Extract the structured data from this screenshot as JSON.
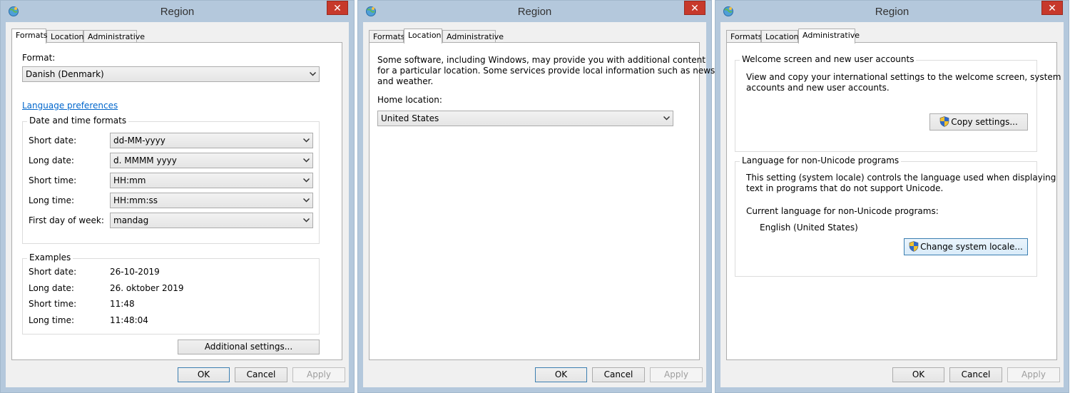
{
  "windows": [
    {
      "title": "Region",
      "close": "✕",
      "tabs": [
        "Formats",
        "Location",
        "Administrative"
      ],
      "active_tab": 0,
      "format_label": "Format:",
      "format_value": "Danish (Denmark)",
      "language_link": "Language preferences",
      "dt_group": "Date and time formats",
      "dt_rows": [
        {
          "label": "Short date:",
          "value": "dd-MM-yyyy"
        },
        {
          "label": "Long date:",
          "value": "d. MMMM yyyy"
        },
        {
          "label": "Short time:",
          "value": "HH:mm"
        },
        {
          "label": "Long time:",
          "value": "HH:mm:ss"
        },
        {
          "label": "First day of week:",
          "value": "mandag"
        }
      ],
      "examples_group": "Examples",
      "examples": [
        {
          "label": "Short date:",
          "value": "26-10-2019"
        },
        {
          "label": "Long date:",
          "value": "26. oktober 2019"
        },
        {
          "label": "Short time:",
          "value": "11:48"
        },
        {
          "label": "Long time:",
          "value": "11:48:04"
        }
      ],
      "additional_button": "Additional settings...",
      "ok": "OK",
      "cancel": "Cancel",
      "apply": "Apply"
    },
    {
      "title": "Region",
      "close": "✕",
      "tabs": [
        "Formats",
        "Location",
        "Administrative"
      ],
      "active_tab": 1,
      "description_line1": "Some software, including Windows, may provide you with additional content",
      "description_line2": "for a particular location. Some services provide local information such as news",
      "description_line3": "and weather.",
      "home_label": "Home location:",
      "home_value": "United States",
      "ok": "OK",
      "cancel": "Cancel",
      "apply": "Apply"
    },
    {
      "title": "Region",
      "close": "✕",
      "tabs": [
        "Formats",
        "Location",
        "Administrative"
      ],
      "active_tab": 2,
      "welcome_group": "Welcome screen and new user accounts",
      "welcome_line1": "View and copy your international settings to the welcome screen, system",
      "welcome_line2": "accounts and new user accounts.",
      "copy_button": "Copy settings...",
      "unicode_group": "Language for non-Unicode programs",
      "unicode_line1": "This setting (system locale) controls the language used when displaying",
      "unicode_line2": "text in programs that do not support Unicode.",
      "current_label": "Current language for non-Unicode programs:",
      "current_value": "English (United States)",
      "change_button": "Change system locale...",
      "ok": "OK",
      "cancel": "Cancel",
      "apply": "Apply"
    }
  ],
  "colors": {
    "frame": "#b4c8dc",
    "close": "#c7392b",
    "link": "#0066cc"
  }
}
